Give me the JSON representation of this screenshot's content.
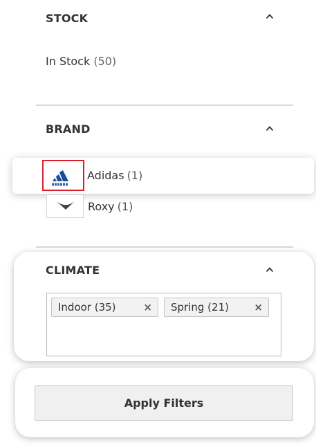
{
  "stock": {
    "title": "STOCK",
    "option_label": "In Stock",
    "option_count": "(50)"
  },
  "brand": {
    "title": "BRAND",
    "items": [
      {
        "label": "Adidas",
        "count": "(1)",
        "icon": "adidas-logo-icon",
        "highlighted": true
      },
      {
        "label": "Roxy",
        "count": "(1)",
        "icon": "roxy-logo-icon",
        "highlighted": false
      }
    ]
  },
  "climate": {
    "title": "CLIMATE",
    "selected": [
      {
        "label": "Indoor (35)",
        "remove": "×"
      },
      {
        "label": "Spring (21)",
        "remove": "×"
      }
    ]
  },
  "apply": {
    "label": "Apply Filters"
  },
  "colors": {
    "highlight_border": "#d9202a",
    "adidas_blue": "#1a4e9a",
    "divider": "#d9d9d9"
  }
}
